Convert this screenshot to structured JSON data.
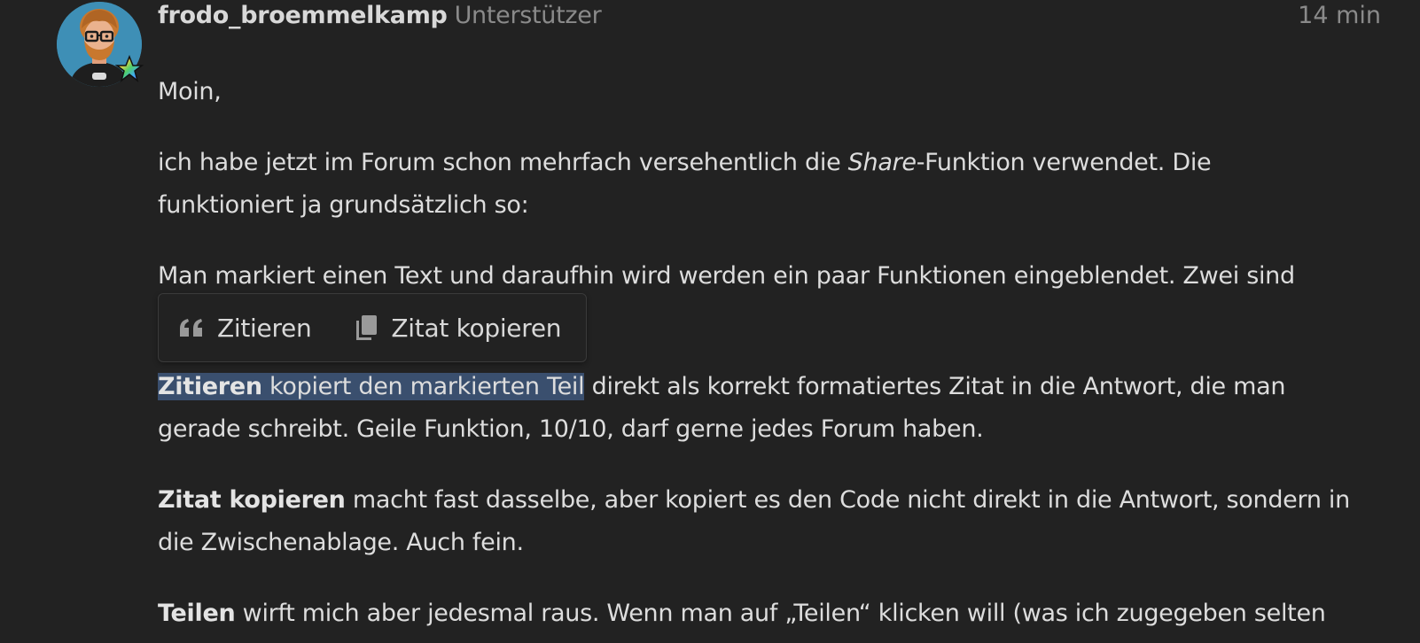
{
  "post": {
    "username": "frodo_broemmelkamp",
    "user_title": "Unterstützer",
    "time": "14 min"
  },
  "content": {
    "greeting": "Moin,",
    "p2_a": "ich habe jetzt im Forum schon mehrfach versehentlich die ",
    "p2_em": "Share",
    "p2_b": "-Funktion verwendet. Die",
    "p2_line2": "funktioniert ja grundsätzlich so:",
    "p3": "Man markiert einen Text und daraufhin wird werden ein paar Funktionen eingeblendet. Zwei sind",
    "p4_sel_bold": "Zitieren",
    "p4_sel_rest": " kopiert den markierten Teil",
    "p4_rest": " direkt als korrekt formatiertes Zitat in die Antwort, die man",
    "p4_line2": "gerade schreibt. Geile Funktion, 10/10, darf gerne jedes Forum haben.",
    "p5_bold": "Zitat kopieren",
    "p5_rest": " macht fast dasselbe, aber kopiert es den Code nicht direkt in die Antwort, sondern in",
    "p5_line2": "die Zwischenablage. Auch fein.",
    "p6_bold": "Teilen",
    "p6_rest": " wirft mich aber jedesmal raus. Wenn man auf „Teilen“ klicken will (was ich zugegeben selten"
  },
  "popup": {
    "quote_label": "Zitieren",
    "copy_quote_label": "Zitat kopieren",
    "quote_icon": "quote-icon",
    "copy_icon": "copy-icon"
  },
  "colors": {
    "background": "#222222",
    "text": "#dddddd",
    "muted": "#8a8a8a",
    "selection": "#3a4f6e"
  }
}
